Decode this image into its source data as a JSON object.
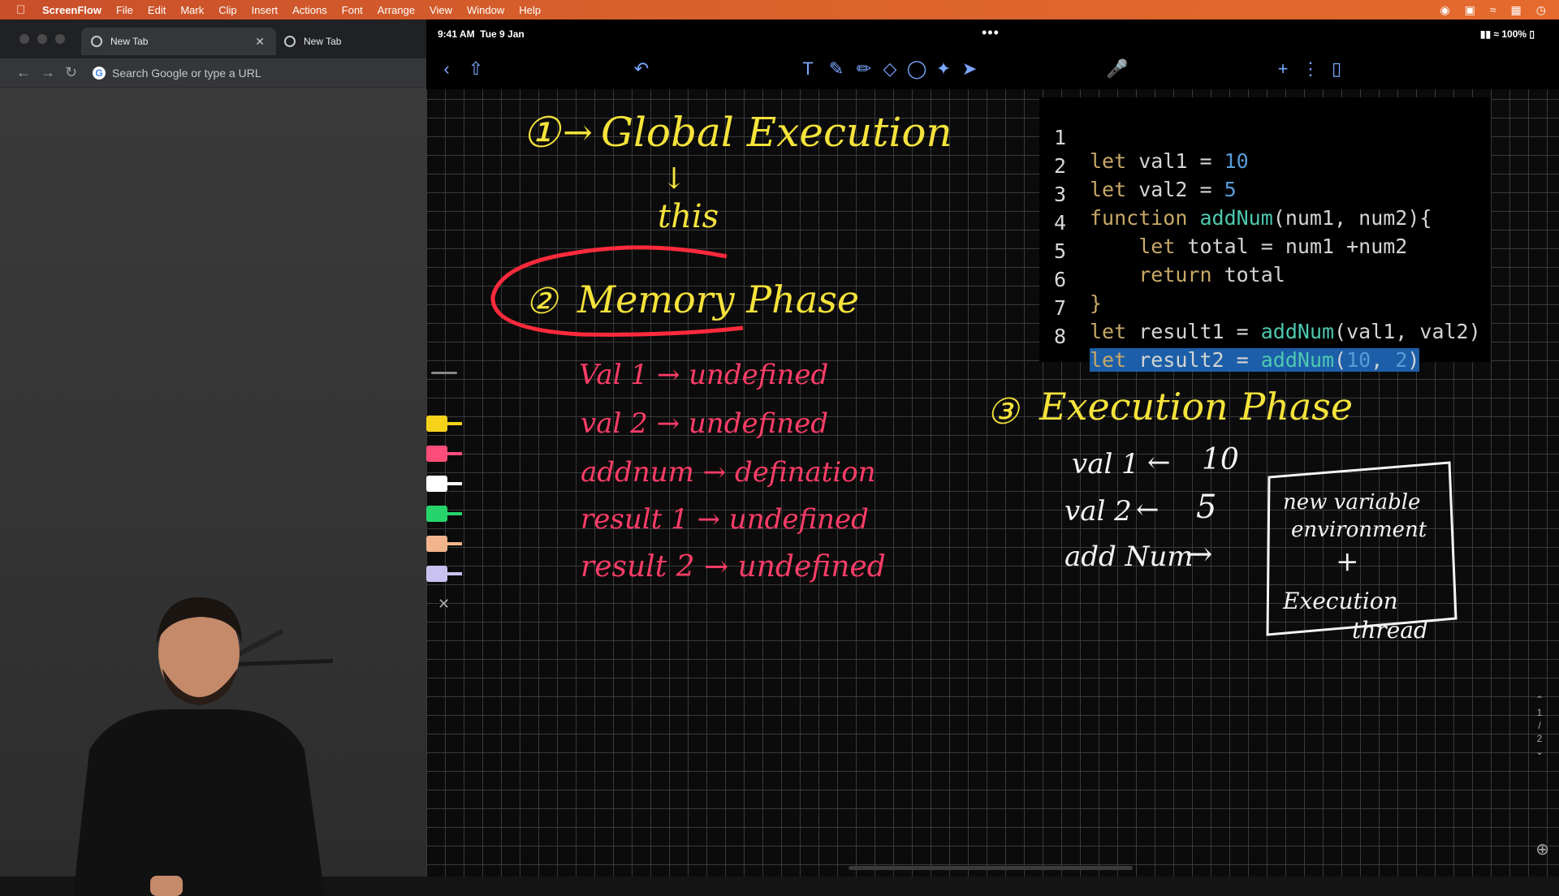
{
  "menubar": {
    "app_name": "ScreenFlow",
    "items": [
      "File",
      "Edit",
      "Mark",
      "Clip",
      "Insert",
      "Actions",
      "Font",
      "Arrange",
      "View",
      "Window",
      "Help"
    ]
  },
  "browser": {
    "tabs": [
      {
        "label": "New Tab"
      },
      {
        "label": "New Tab"
      }
    ],
    "address_placeholder": "Search Google or type a URL"
  },
  "ipad_status": {
    "time": "9:41 AM",
    "date": "Tue 9 Jan",
    "battery": "100%"
  },
  "code": {
    "lines": [
      {
        "n": "1"
      },
      {
        "n": "2"
      },
      {
        "n": "3"
      },
      {
        "n": "4"
      },
      {
        "n": "5"
      },
      {
        "n": "6"
      },
      {
        "n": "7"
      },
      {
        "n": "8"
      }
    ],
    "text": {
      "l1_let": "let",
      "l1_rest": " val1 = ",
      "l1_num": "10",
      "l2_let": "let",
      "l2_rest": " val2 = ",
      "l2_num": "5",
      "l3_kw": "function",
      "l3_fn": " addNum",
      "l3_rest": "(num1, num2){",
      "l4_let": "let",
      "l4_rest": " total = num1 +num2",
      "l5_ret": "return",
      "l5_rest": " total",
      "l6": "}",
      "l7_let": "let",
      "l7_rest": " result1 = ",
      "l7_fn": "addNum",
      "l7_args": "(val1, val2)",
      "l8_let": "let",
      "l8_rest": " result2 = ",
      "l8_fn": "addNum",
      "l8_p1": "(",
      "l8_n1": "10",
      "l8_c": ", ",
      "l8_n2": "2",
      "l8_p2": ")"
    }
  },
  "notes": {
    "global": {
      "num": "①",
      "arrow": "→",
      "text": "Global Execution",
      "down": "↓",
      "this": "this"
    },
    "memory": {
      "num": "②",
      "text": "Memory Phase"
    },
    "memory_items": [
      "Val 1 → undefined",
      "val 2 → undefined",
      "addnum → defination",
      "result 1 → undefined",
      "result 2 → undefined"
    ],
    "execution": {
      "num": "③",
      "text": "Execution Phase"
    },
    "exec_items": [
      {
        "left": "val 1",
        "arrow": "←",
        "right": "10"
      },
      {
        "left": "val 2",
        "arrow": "←",
        "right": "5"
      },
      {
        "left": "add Num",
        "arrow": "→",
        "right": ""
      }
    ],
    "box": {
      "line1": "new variable",
      "line2": "environment",
      "plus": "+",
      "line3": "Execution",
      "line4": "thread"
    }
  },
  "colors": {
    "yellow_ink": "#f6e33b",
    "pink_ink": "#ff3d68",
    "highlight": "#1c5fa8",
    "toolbar_icon": "#7aa7ff"
  },
  "pen_tray": [
    "#f6d21a",
    "#ff4d7a",
    "#ffffff",
    "#26d46b",
    "#f2b48c",
    "#c9c2f0"
  ],
  "page_indicator": [
    "1",
    "/",
    "2"
  ]
}
